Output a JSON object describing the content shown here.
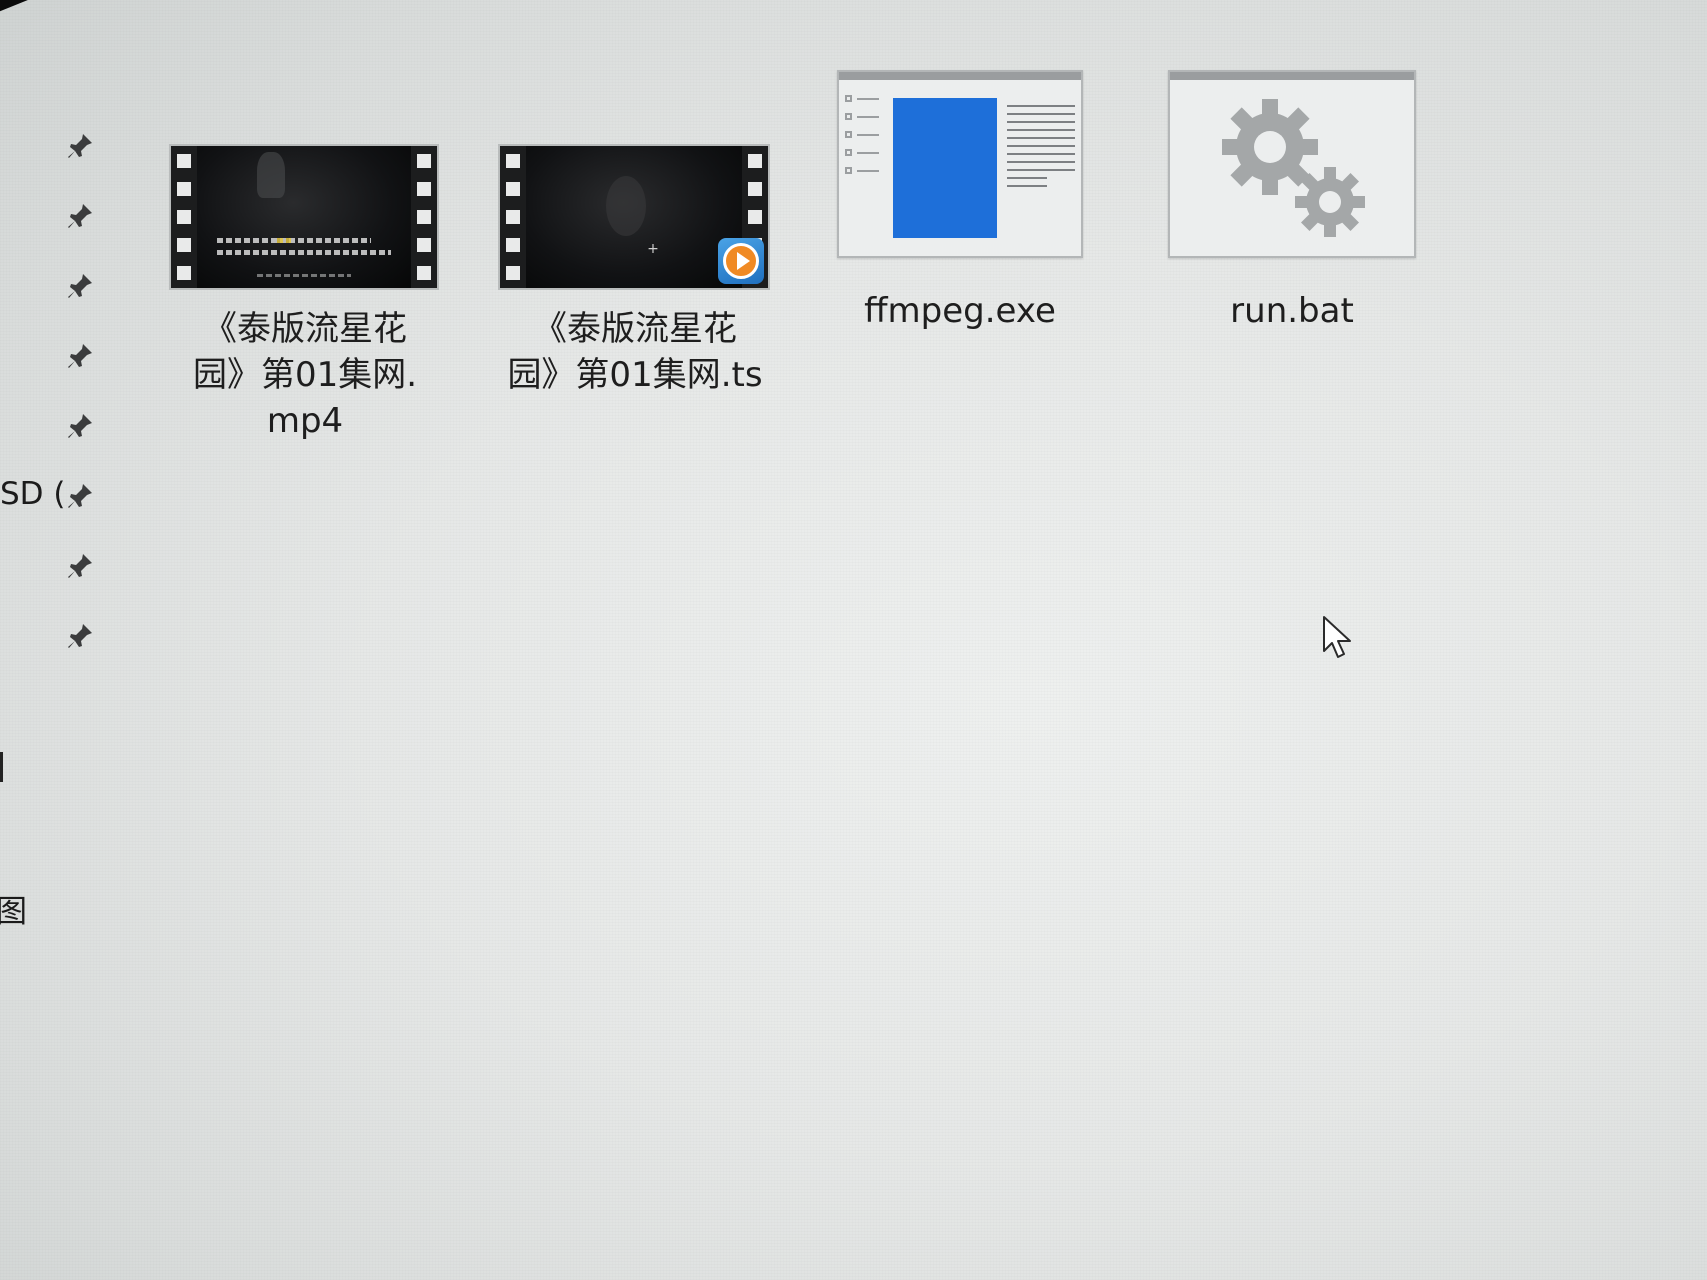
{
  "nav_pane": {
    "drive_label": "SD (",
    "partial_char": "图",
    "pinned_count": 8,
    "pin_icon": "pin-icon"
  },
  "files": [
    {
      "name": "《泰版流星花园》第01集网.mp4",
      "label_lines": [
        "《泰版流星花",
        "园》第01集网.",
        "mp4"
      ],
      "icon": "video-thumbnail-icon"
    },
    {
      "name": "《泰版流星花园》第01集网.ts",
      "label_lines": [
        "《泰版流星花",
        "园》第01集网.ts"
      ],
      "icon": "video-thumbnail-player-icon"
    },
    {
      "name": "ffmpeg.exe",
      "label_lines": [
        "ffmpeg.exe"
      ],
      "icon": "application-window-icon"
    },
    {
      "name": "run.bat",
      "label_lines": [
        "run.bat"
      ],
      "icon": "batch-gears-icon"
    }
  ],
  "colors": {
    "background": "#e6e8e7",
    "label_text": "#1e1e1e",
    "app_blue": "#1e6fd9",
    "gear_gray": "#a4a7a8",
    "play_orange": "#f08a24"
  },
  "cursor": "arrow-cursor-icon"
}
